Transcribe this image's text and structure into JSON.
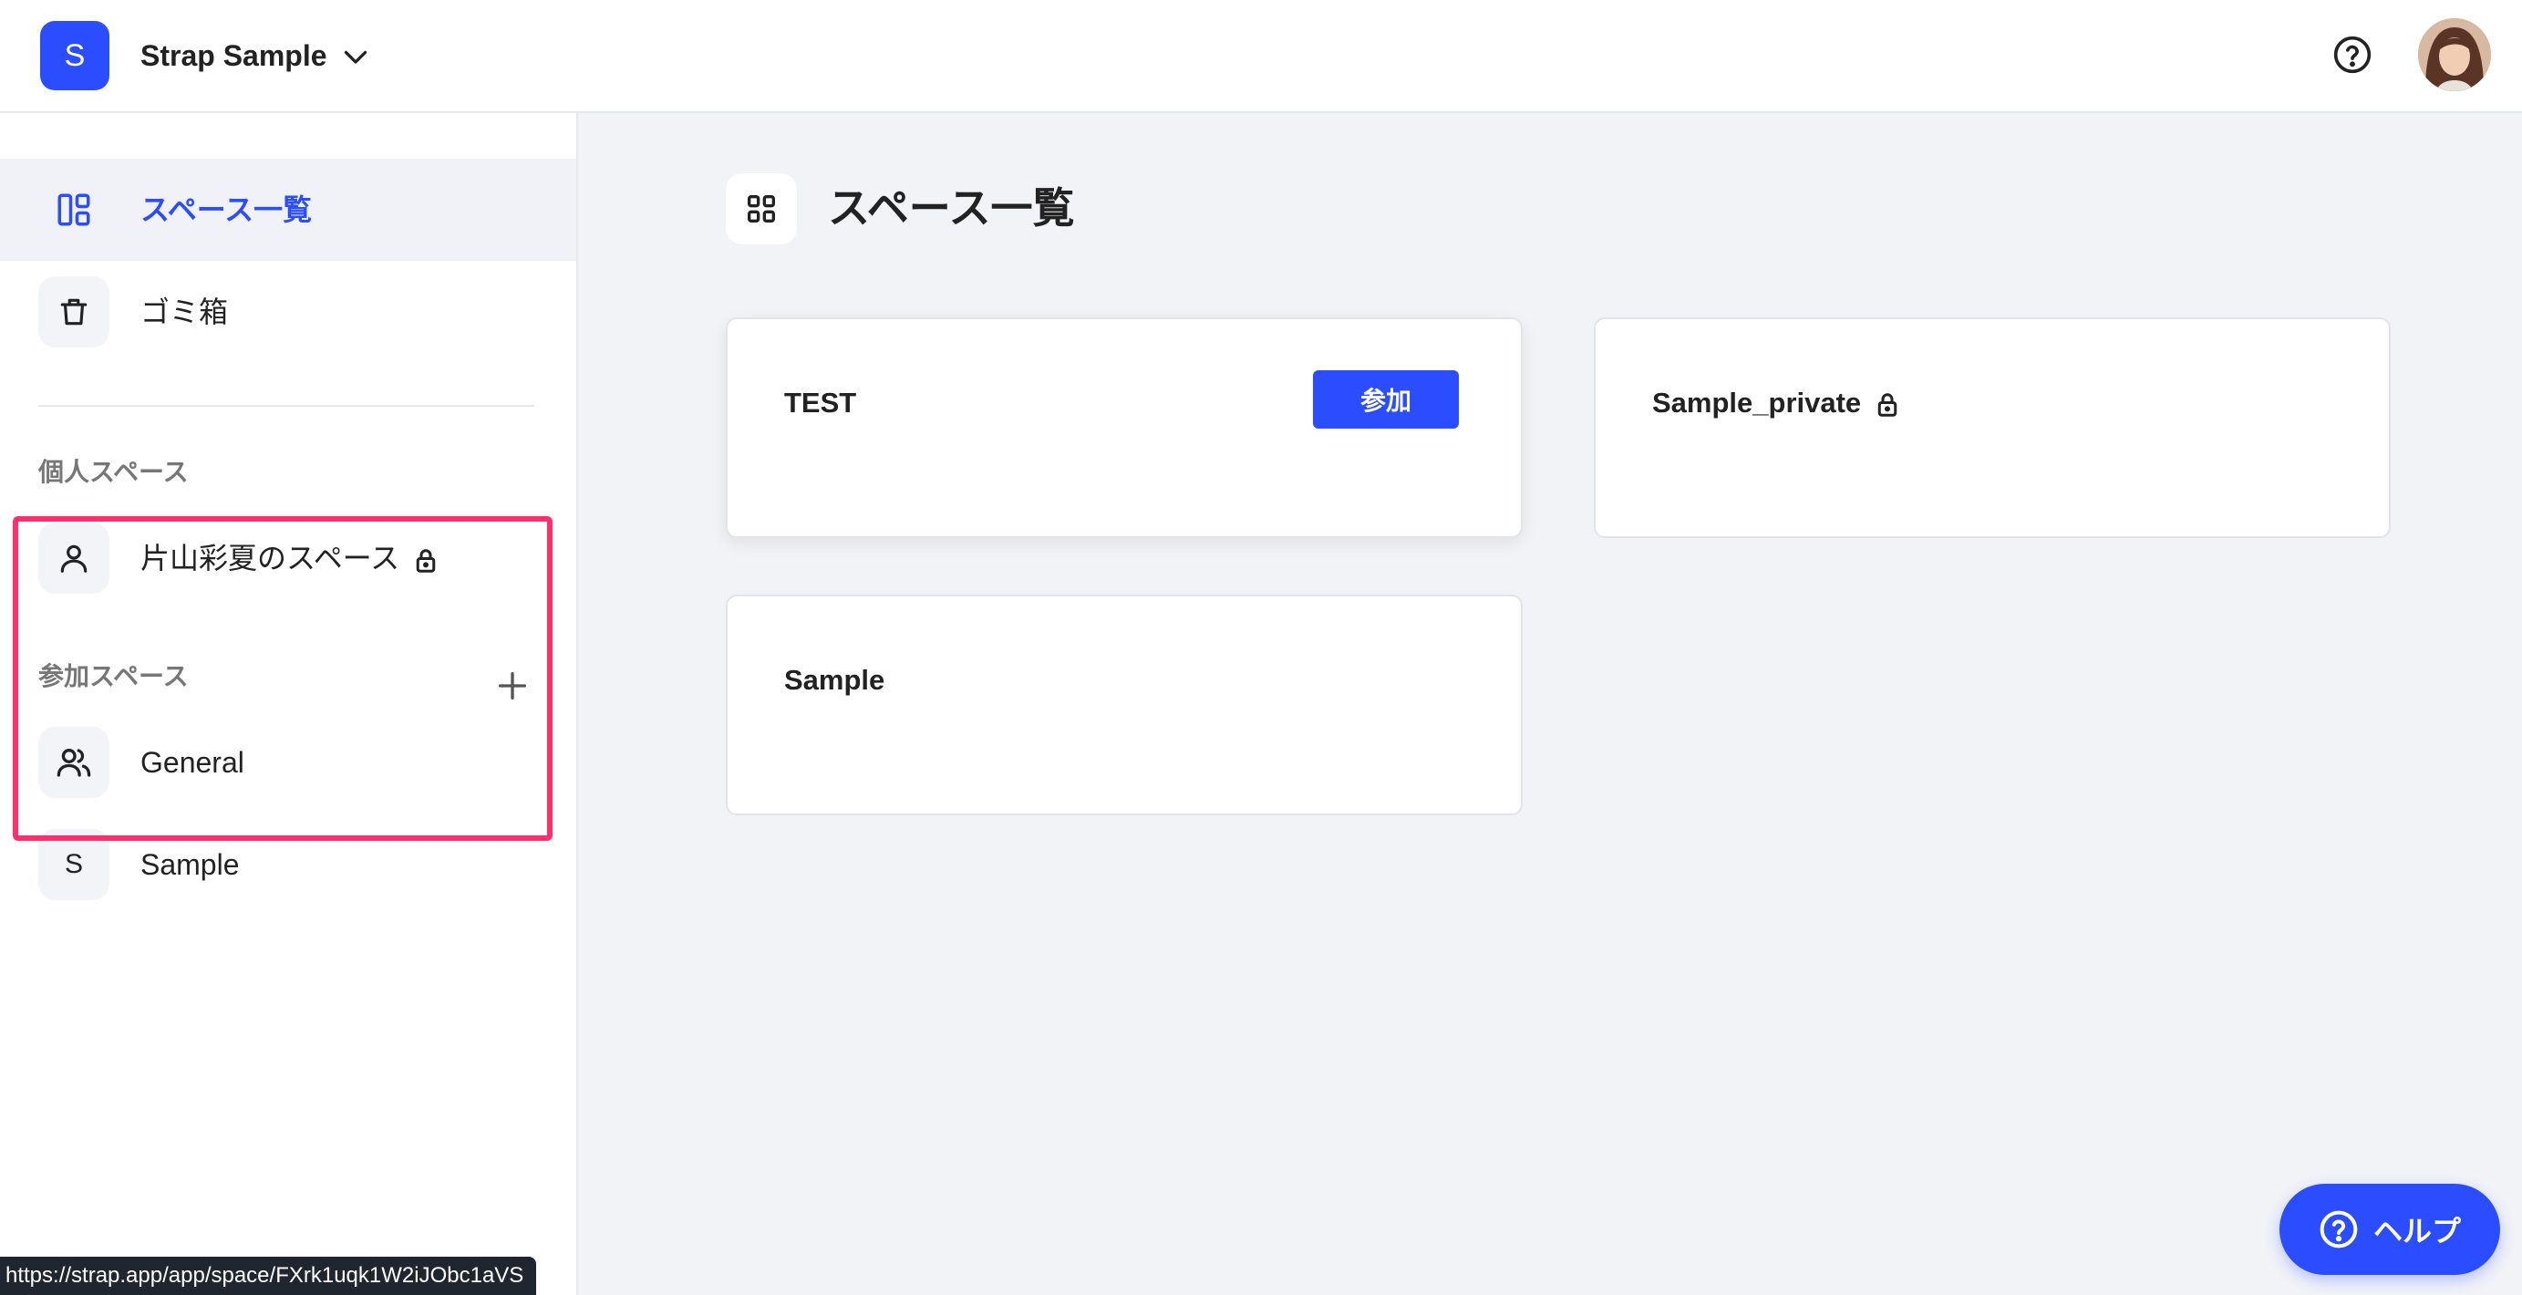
{
  "header": {
    "workspace_initial": "S",
    "workspace_name": "Strap Sample",
    "accent_color": "#2a4dff"
  },
  "sidebar": {
    "nav": [
      {
        "label": "スペース一覧",
        "icon": "dashboard-icon",
        "active": true
      },
      {
        "label": "ゴミ箱",
        "icon": "trash-icon",
        "active": false
      }
    ],
    "personal_section_title": "個人スペース",
    "personal_space": {
      "label": "片山彩夏のスペース",
      "icon": "user-icon",
      "locked": true
    },
    "joined_section_title": "参加スペース",
    "joined_spaces": [
      {
        "label": "General",
        "icon": "users-icon"
      },
      {
        "label": "Sample",
        "initial": "S"
      }
    ]
  },
  "main": {
    "title": "スペース一覧",
    "cards": [
      {
        "title": "TEST",
        "join_label": "参加"
      },
      {
        "title": "Sample_private",
        "locked": true
      },
      {
        "title": "Sample"
      }
    ]
  },
  "help_button_label": "ヘルプ",
  "status_url": "https://strap.app/app/space/FXrk1uqk1W2iJObc1aVS",
  "highlight_color": "#ff2f6e"
}
